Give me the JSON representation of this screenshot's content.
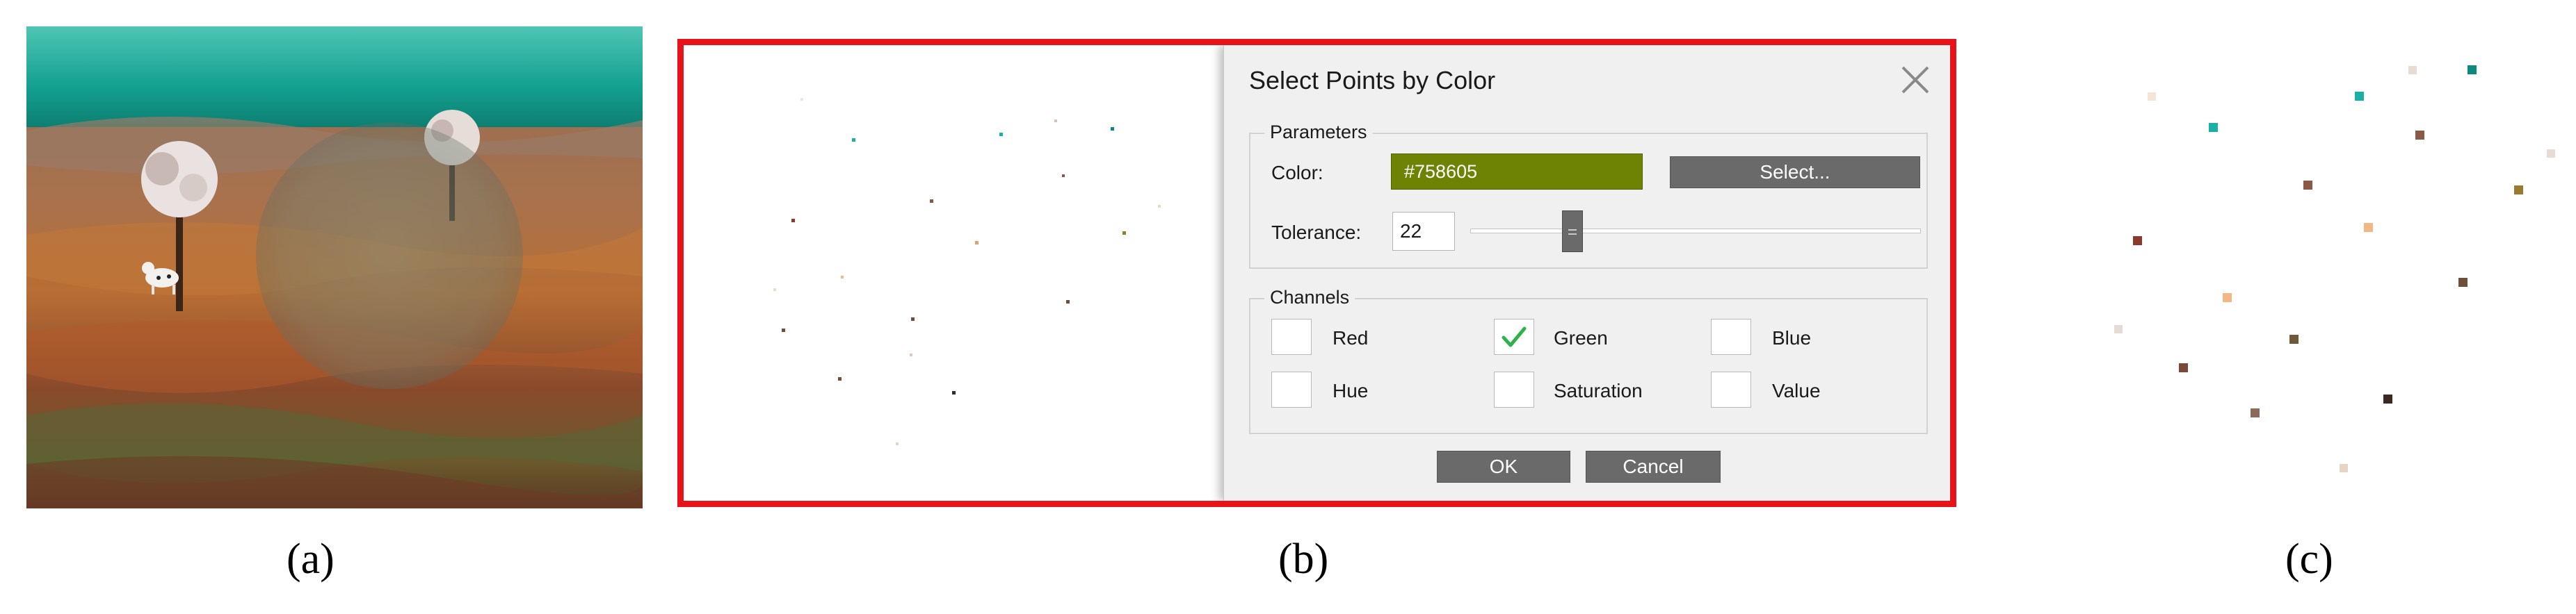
{
  "captions": {
    "a": "(a)",
    "b": "(b)",
    "c": "(c)"
  },
  "dialog": {
    "title": "Select Points by Color",
    "close_icon": "close-icon",
    "parameters": {
      "group_label": "Parameters",
      "color_label": "Color:",
      "color_value": "#758605",
      "color_swatch": "#6e8204",
      "select_button": "Select...",
      "tolerance_label": "Tolerance:",
      "tolerance_value": "22"
    },
    "channels": {
      "group_label": "Channels",
      "items": [
        {
          "label": "Red",
          "checked": false
        },
        {
          "label": "Green",
          "checked": true
        },
        {
          "label": "Blue",
          "checked": false
        },
        {
          "label": "Hue",
          "checked": false
        },
        {
          "label": "Saturation",
          "checked": false
        },
        {
          "label": "Value",
          "checked": false
        }
      ]
    },
    "ok_button": "OK",
    "cancel_button": "Cancel"
  },
  "colors": {
    "frame_red": "#e8121a",
    "button_gray": "#6a6a6a",
    "check_green": "#2fb24a",
    "sky_teal": "#1a9e90"
  }
}
